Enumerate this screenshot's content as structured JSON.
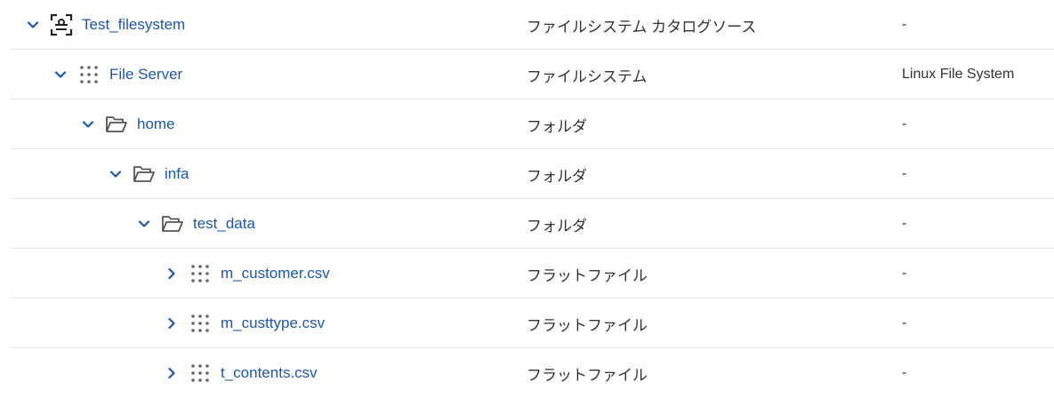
{
  "colors": {
    "link": "#1a56b8",
    "text": "#333333",
    "divider": "#e3e3e3",
    "icon": "#555555"
  },
  "rows": [
    {
      "name": "Test_filesystem",
      "type": "ファイルシステム カタログソース",
      "subtype": "-",
      "expanded": true,
      "icon": "catalog-source-icon"
    },
    {
      "name": "File Server",
      "type": "ファイルシステム",
      "subtype": "Linux File System",
      "expanded": true,
      "icon": "grid-dots-icon"
    },
    {
      "name": "home",
      "type": "フォルダ",
      "subtype": "-",
      "expanded": true,
      "icon": "folder-open-icon"
    },
    {
      "name": "infa",
      "type": "フォルダ",
      "subtype": "-",
      "expanded": true,
      "icon": "folder-open-icon"
    },
    {
      "name": "test_data",
      "type": "フォルダ",
      "subtype": "-",
      "expanded": true,
      "icon": "folder-open-icon"
    },
    {
      "name": "m_customer.csv",
      "type": "フラットファイル",
      "subtype": "-",
      "expanded": false,
      "icon": "grid-dots-icon"
    },
    {
      "name": "m_custtype.csv",
      "type": "フラットファイル",
      "subtype": "-",
      "expanded": false,
      "icon": "grid-dots-icon"
    },
    {
      "name": "t_contents.csv",
      "type": "フラットファイル",
      "subtype": "-",
      "expanded": false,
      "icon": "grid-dots-icon"
    }
  ]
}
